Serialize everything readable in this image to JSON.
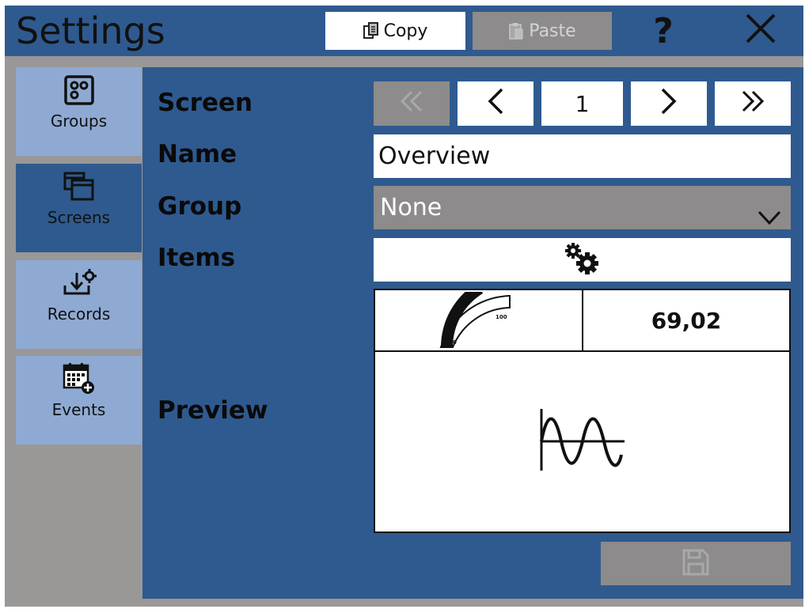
{
  "window": {
    "title": "Settings",
    "copy_label": "Copy",
    "paste_label": "Paste",
    "help_label": "?"
  },
  "sidebar": {
    "items": [
      {
        "label": "Groups",
        "icon": "groups-icon",
        "active": false
      },
      {
        "label": "Screens",
        "icon": "screens-icon",
        "active": true
      },
      {
        "label": "Records",
        "icon": "records-icon",
        "active": false
      },
      {
        "label": "Events",
        "icon": "events-icon",
        "active": false
      }
    ]
  },
  "form": {
    "screen_label": "Screen",
    "name_label": "Name",
    "group_label": "Group",
    "items_label": "Items",
    "preview_label": "Preview",
    "screen_number": "1",
    "name_value": "Overview",
    "group_value": "None"
  },
  "preview": {
    "value": "69,02",
    "gauge_min": "0",
    "gauge_max": "100",
    "gauge_level": 0.69
  },
  "colors": {
    "accent": "#2f5a8f",
    "sidebar_item": "#8eaad3",
    "disabled": "#8d8b8b",
    "background": "#9a9797"
  }
}
